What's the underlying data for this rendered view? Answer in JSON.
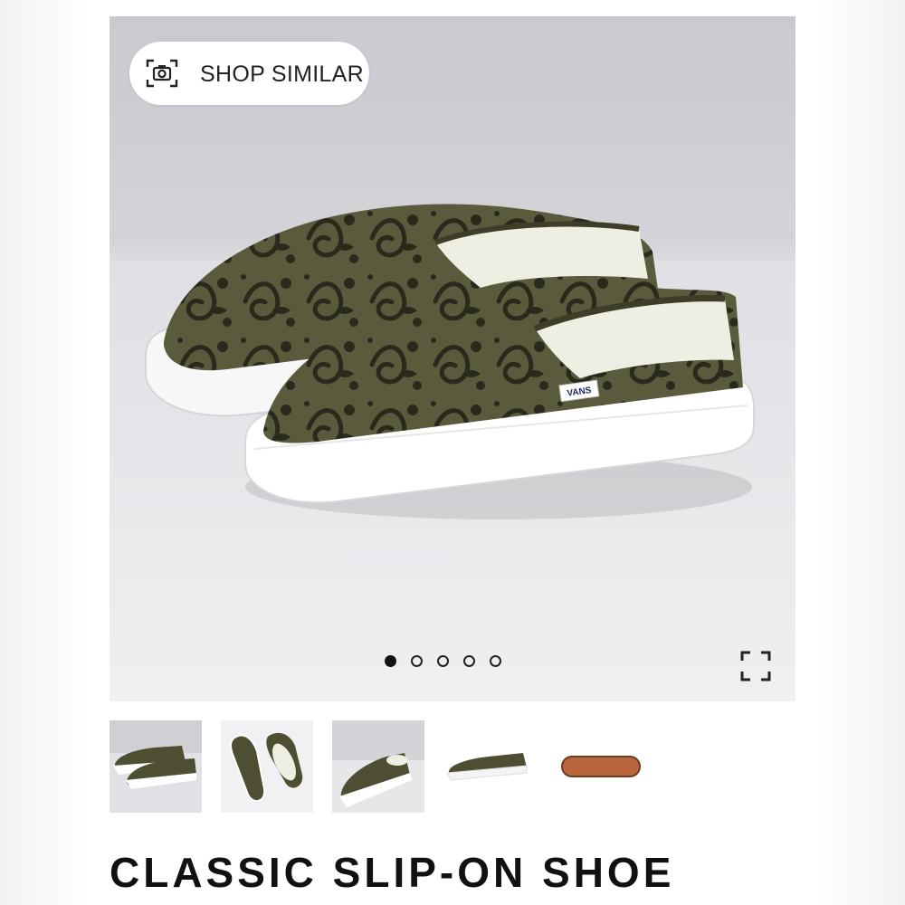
{
  "hero": {
    "shop_similar_label": "SHOP SIMILAR",
    "camera_icon": "camera-scan-icon",
    "expand_icon": "fullscreen-expand-icon",
    "carousel": {
      "total_slides": 5,
      "active_index": 0
    }
  },
  "thumbnails": {
    "count": 5,
    "selected_index": 0,
    "selected_border_color": "#c8102e"
  },
  "product": {
    "title": "CLASSIC SLIP-ON SHOE",
    "brand_tag": "VANS",
    "upper_color": "#5a5a3c",
    "pattern_color": "#2a2a1c",
    "sole_color": "#ffffff"
  }
}
